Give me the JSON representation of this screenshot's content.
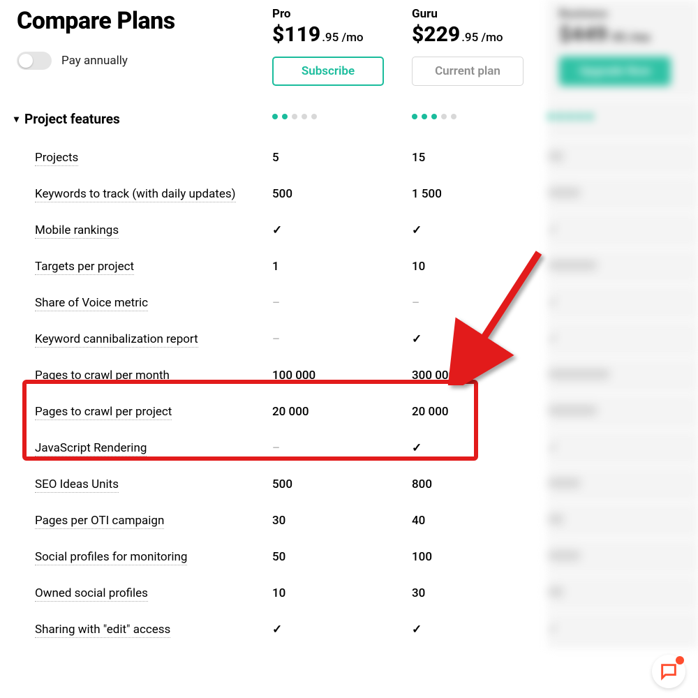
{
  "title": "Compare Plans",
  "toggle_label": "Pay annually",
  "section": "Project features",
  "plans": {
    "pro": {
      "name": "Pro",
      "price_main": "$119",
      "price_sub": ".95 /mo",
      "cta": "Subscribe",
      "dots_filled": 2,
      "dots_total": 5
    },
    "guru": {
      "name": "Guru",
      "price_main": "$229",
      "price_sub": ".95 /mo",
      "cta": "Current plan",
      "dots_filled": 3,
      "dots_total": 5
    },
    "business": {
      "name": "Business",
      "price_main": "$449",
      "price_sub": ".95 /mo",
      "cta": "Upgrade Now",
      "dots_filled": 5,
      "dots_total": 5
    }
  },
  "features": [
    {
      "label": "Projects",
      "pro": "5",
      "guru": "15",
      "biz": "40"
    },
    {
      "label": "Keywords to track (with daily updates)",
      "pro": "500",
      "guru": "1 500",
      "biz": "5 000"
    },
    {
      "label": "Mobile rankings",
      "pro": "check",
      "guru": "check",
      "biz": "check"
    },
    {
      "label": "Targets per project",
      "pro": "1",
      "guru": "10",
      "biz": "unlimited"
    },
    {
      "label": "Share of Voice metric",
      "pro": "dash",
      "guru": "dash",
      "biz": "check"
    },
    {
      "label": "Keyword cannibalization report",
      "pro": "dash",
      "guru": "check",
      "biz": "check"
    },
    {
      "label": "Pages to crawl per month",
      "pro": "100 000",
      "guru": "300 000",
      "biz": "1 000 000"
    },
    {
      "label": "Pages to crawl per project",
      "pro": "20 000",
      "guru": "20 000",
      "biz": "100 000"
    },
    {
      "label": "JavaScript Rendering",
      "pro": "dash",
      "guru": "check",
      "biz": "check"
    },
    {
      "label": "SEO Ideas Units",
      "pro": "500",
      "guru": "800",
      "biz": "2 000"
    },
    {
      "label": "Pages per OTI campaign",
      "pro": "30",
      "guru": "40",
      "biz": "50"
    },
    {
      "label": "Social profiles for monitoring",
      "pro": "50",
      "guru": "100",
      "biz": "300"
    },
    {
      "label": "Owned social profiles",
      "pro": "10",
      "guru": "30",
      "biz": "50"
    },
    {
      "label": "Sharing with \"edit\" access",
      "pro": "check",
      "guru": "check",
      "biz": "check"
    }
  ]
}
